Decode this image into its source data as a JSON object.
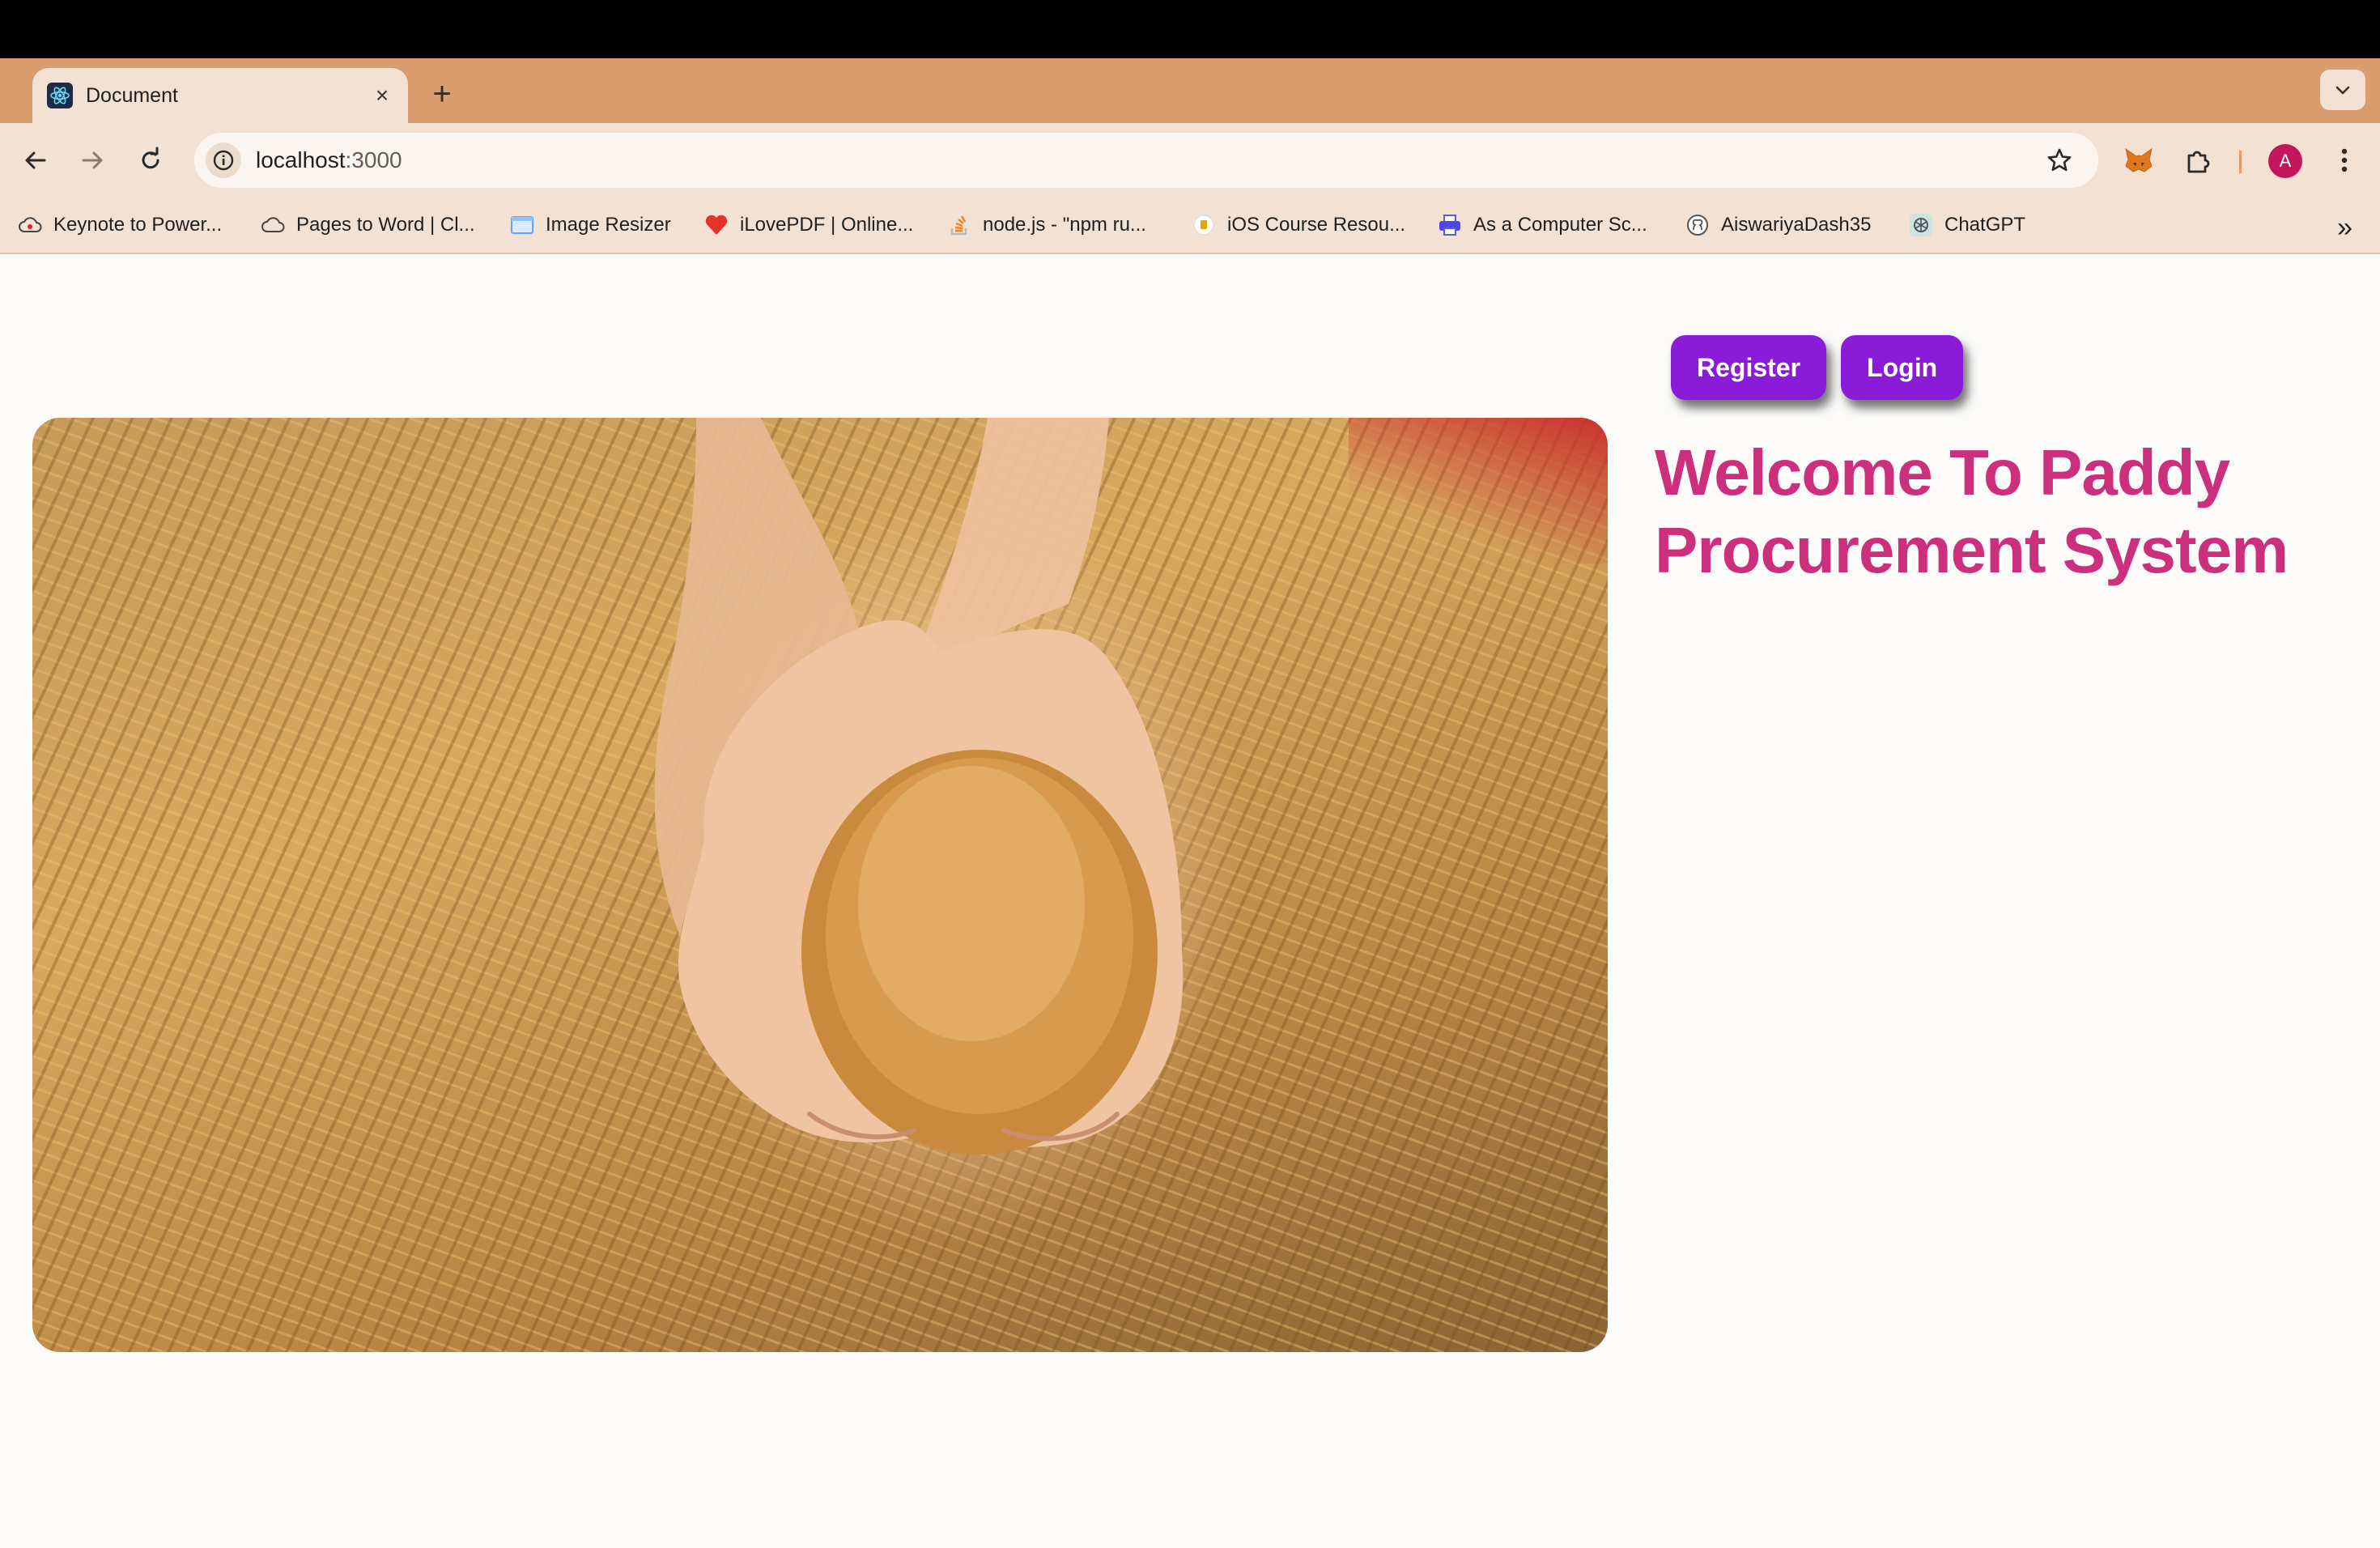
{
  "browser": {
    "tab": {
      "title": "Document",
      "close_glyph": "×",
      "favicon": "react-icon"
    },
    "new_tab_glyph": "+",
    "address_bar": {
      "host": "localhost",
      "port": ":3000"
    },
    "avatar_initial": "A",
    "colors": {
      "tabstrip": "#d99d6f",
      "toolbar": "#f3e2d4"
    }
  },
  "bookmarks": {
    "items": [
      {
        "label": "Keynote to Power...",
        "icon": "cloud-icon"
      },
      {
        "label": "Pages to Word | Cl...",
        "icon": "cloud-icon"
      },
      {
        "label": "Image Resizer",
        "icon": "image-icon"
      },
      {
        "label": "iLovePDF | Online...",
        "icon": "heart-icon"
      },
      {
        "label": "node.js - \"npm ru...",
        "icon": "stackoverflow-icon"
      },
      {
        "label": "iOS Course Resou...",
        "icon": "course-icon"
      },
      {
        "label": "As a Computer Sc...",
        "icon": "printer-icon"
      },
      {
        "label": "AiswariyaDash35",
        "icon": "github-icon"
      },
      {
        "label": "ChatGPT",
        "icon": "chatgpt-icon"
      }
    ],
    "more_glyph": "»"
  },
  "page": {
    "buttons": {
      "register": "Register",
      "login": "Login"
    },
    "heading": "Welcome To Paddy Procurement System",
    "hero_image": "hands-holding-paddy-grains",
    "colors": {
      "button": "#8a1bd8",
      "heading": "#cc2f7b",
      "background": "#fcfbf9"
    }
  }
}
